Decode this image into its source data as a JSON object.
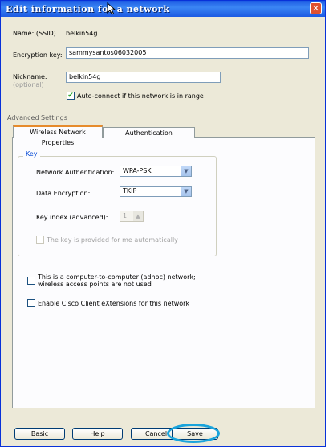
{
  "window": {
    "title": "Edit information for a network"
  },
  "form": {
    "ssid_label": "Name: (SSID)",
    "ssid_value": "belkin54g",
    "encryption_key_label": "Encryption key:",
    "encryption_key_value": "sammysantos06032005",
    "nickname_label": "Nickname:",
    "nickname_sub": "(optional)",
    "nickname_value": "belkin54g",
    "autoconnect_label": "Auto-connect if this network is in range",
    "autoconnect_checked": true,
    "advanced_label": "Advanced Settings"
  },
  "tabs": [
    {
      "label": "Wireless Network Properties",
      "active": true
    },
    {
      "label": "Authentication",
      "active": false
    }
  ],
  "key_group": {
    "title": "Key",
    "network_auth_label": "Network Authentication:",
    "network_auth_value": "WPA-PSK",
    "data_encryption_label": "Data Encryption:",
    "data_encryption_value": "TKIP",
    "key_index_label": "Key index (advanced):",
    "key_index_value": "1",
    "auto_key_label": "The key is provided for me automatically"
  },
  "options": {
    "adhoc_line1": "This is a computer-to-computer (adhoc) network;",
    "adhoc_line2": "wireless access points are not used",
    "cisco_label": "Enable Cisco Client eXtensions for this network"
  },
  "buttons": {
    "basic": "Basic",
    "help": "Help",
    "cancel": "Cancel",
    "save": "Save"
  },
  "colors": {
    "titlebar": "#1c5ae3",
    "highlight_ring": "#1aa4dc",
    "tab_accent": "#e68b2c"
  }
}
